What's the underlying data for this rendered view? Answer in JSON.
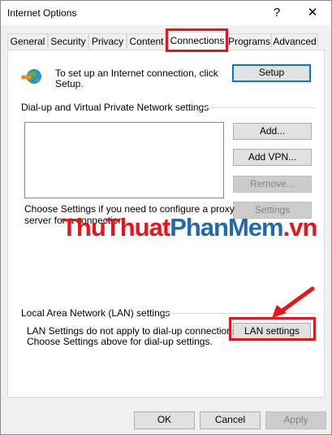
{
  "window": {
    "title": "Internet Options",
    "help_glyph": "?",
    "close_glyph": "✕"
  },
  "tabs": [
    {
      "label": "General"
    },
    {
      "label": "Security"
    },
    {
      "label": "Privacy"
    },
    {
      "label": "Content"
    },
    {
      "label": "Connections",
      "active": true
    },
    {
      "label": "Programs"
    },
    {
      "label": "Advanced"
    }
  ],
  "setup": {
    "text_line1": "To set up an Internet connection, click",
    "text_line2": "Setup.",
    "button": "Setup",
    "icon": "globe-network-icon"
  },
  "dialup": {
    "heading": "Dial-up and Virtual Private Network settings",
    "add_button": "Add...",
    "add_vpn_button": "Add VPN...",
    "remove_button": "Remove...",
    "settings_button": "Settings",
    "note_line1": "Choose Settings if you need to configure a proxy",
    "note_line2": "server for a connection."
  },
  "lan": {
    "heading": "Local Area Network (LAN) settings",
    "note_line1": "LAN Settings do not apply to dial-up connections.",
    "note_line2": "Choose Settings above for dial-up settings.",
    "button": "LAN settings"
  },
  "footer": {
    "ok": "OK",
    "cancel": "Cancel",
    "apply": "Apply"
  },
  "watermark": {
    "part1": "ThuThuat",
    "part2": "PhanMem",
    "part3": ".vn"
  },
  "colors": {
    "highlight": "#e8141b",
    "accent": "#0078d7"
  }
}
